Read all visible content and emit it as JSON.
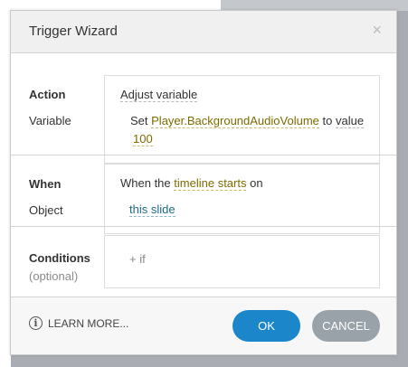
{
  "dialog": {
    "title": "Trigger Wizard",
    "close_glyph": "×"
  },
  "action": {
    "label": "Action",
    "value": "Adjust variable"
  },
  "variable": {
    "label": "Variable",
    "prefix": "Set",
    "name": "Player.BackgroundAudioVolume",
    "to": "to",
    "operator": "value",
    "value": "100"
  },
  "when": {
    "label": "When",
    "prefix": "When the",
    "event": "timeline starts",
    "suffix": "on"
  },
  "object": {
    "label": "Object",
    "value": "this slide"
  },
  "conditions": {
    "label": "Conditions",
    "sublabel": "(optional)",
    "add": "+ if"
  },
  "footer": {
    "learn_more": "LEARN MORE...",
    "ok": "OK",
    "cancel": "CANCEL"
  },
  "colors": {
    "ok_button": "#1b86c9",
    "cancel_button": "#98a2a8",
    "variable_link": "#7d6b00",
    "object_link": "#1f6a8c"
  },
  "icons": {
    "info": "info-icon",
    "close": "close-icon"
  }
}
